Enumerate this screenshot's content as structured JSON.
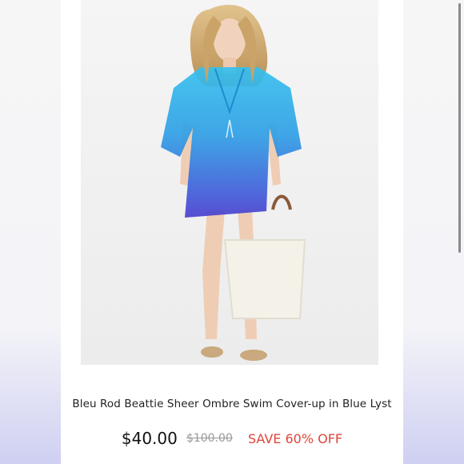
{
  "product": {
    "title": "Bleu Rod Beattie Sheer Ombre Swim Cover-up in Blue Lyst",
    "price": "$40.00",
    "original_price": "$100.00",
    "discount_label": "SAVE 60% OFF",
    "image_alt": "Model wearing blue ombre sheer swim cover-up holding a woven tote bag"
  },
  "colors": {
    "price_text": "#111111",
    "original_price_text": "#999999",
    "discount_text": "#e0453a",
    "cover_up_top": "#33b8ea",
    "cover_up_bottom": "#4b3fd0"
  },
  "icons": {
    "scrollbar": "scrollbar-thumb"
  }
}
